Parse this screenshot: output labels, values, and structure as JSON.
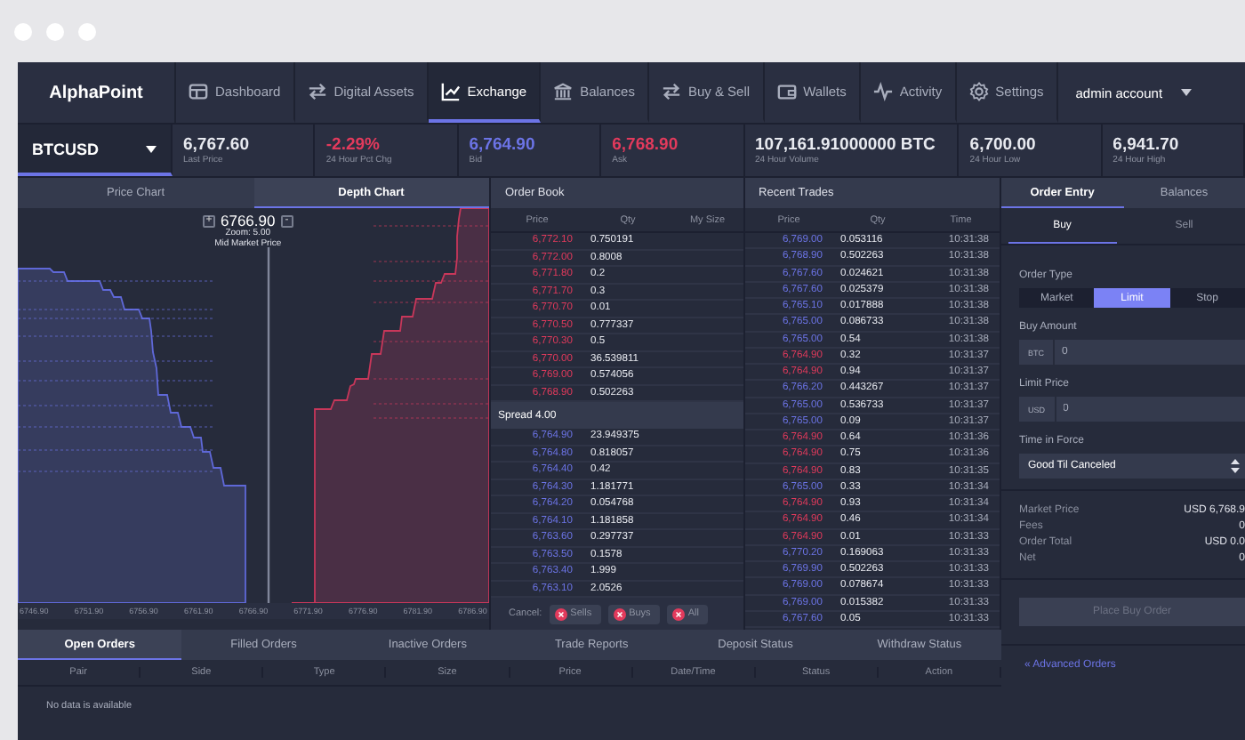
{
  "nav": {
    "logo": "AlphaPoint",
    "items": [
      {
        "label": "Dashboard",
        "selected": false
      },
      {
        "label": "Digital Assets",
        "selected": false
      },
      {
        "label": "Exchange",
        "selected": true
      },
      {
        "label": "Balances",
        "selected": false
      },
      {
        "label": "Buy & Sell",
        "selected": false
      },
      {
        "label": "Wallets",
        "selected": false
      },
      {
        "label": "Activity",
        "selected": false
      },
      {
        "label": "Settings",
        "selected": false
      }
    ],
    "account": "admin account"
  },
  "ticker": {
    "pair": "BTCUSD",
    "stats": [
      {
        "value": "6,767.60",
        "label": "Last Price",
        "kind": "plain"
      },
      {
        "value": "-2.29%",
        "label": "24 Hour Pct Chg",
        "kind": "sell"
      },
      {
        "value": "6,764.90",
        "label": "Bid",
        "kind": "buy"
      },
      {
        "value": "6,768.90",
        "label": "Ask",
        "kind": "sell"
      },
      {
        "value": "107,161.91000000 BTC",
        "label": "24 Hour Volume",
        "kind": "plain"
      },
      {
        "value": "6,700.00",
        "label": "24 Hour Low",
        "kind": "plain"
      },
      {
        "value": "6,941.70",
        "label": "24 Hour High",
        "kind": "plain"
      }
    ]
  },
  "chart_tabs": [
    {
      "label": "Price Chart",
      "selected": false
    },
    {
      "label": "Depth Chart",
      "selected": true
    }
  ],
  "depth_chart": {
    "mid_price": "6766.90",
    "zoom_in": "+",
    "zoom_out": "-",
    "zoom": "Zoom: 5.00",
    "mid_label": "Mid Market Price",
    "x_labels": [
      "6746.90",
      "6751.90",
      "6756.90",
      "6761.90",
      "6766.90",
      "6771.90",
      "6776.90",
      "6781.90",
      "6786.90"
    ]
  },
  "order_book": {
    "title": "Order Book",
    "columns": [
      "Price",
      "Qty",
      "My Size"
    ],
    "asks": [
      {
        "price": "6,772.10",
        "qty": "0.750191"
      },
      {
        "price": "6,772.00",
        "qty": "0.8008"
      },
      {
        "price": "6,771.80",
        "qty": "0.2"
      },
      {
        "price": "6,771.70",
        "qty": "0.3"
      },
      {
        "price": "6,770.70",
        "qty": "0.01"
      },
      {
        "price": "6,770.50",
        "qty": "0.777337"
      },
      {
        "price": "6,770.30",
        "qty": "0.5"
      },
      {
        "price": "6,770.00",
        "qty": "36.539811"
      },
      {
        "price": "6,769.00",
        "qty": "0.574056"
      },
      {
        "price": "6,768.90",
        "qty": "0.502263"
      }
    ],
    "spread": "Spread 4.00",
    "bids": [
      {
        "price": "6,764.90",
        "qty": "23.949375"
      },
      {
        "price": "6,764.80",
        "qty": "0.818057"
      },
      {
        "price": "6,764.40",
        "qty": "0.42"
      },
      {
        "price": "6,764.30",
        "qty": "1.181771"
      },
      {
        "price": "6,764.20",
        "qty": "0.054768"
      },
      {
        "price": "6,764.10",
        "qty": "1.181858"
      },
      {
        "price": "6,763.60",
        "qty": "0.297737"
      },
      {
        "price": "6,763.50",
        "qty": "0.1578"
      },
      {
        "price": "6,763.40",
        "qty": "1.999"
      },
      {
        "price": "6,763.10",
        "qty": "2.0526"
      }
    ],
    "cancel_label": "Cancel:",
    "cancel_buttons": [
      "Sells",
      "Buys",
      "All"
    ]
  },
  "recent_trades": {
    "title": "Recent Trades",
    "columns": [
      "Price",
      "Qty",
      "Time"
    ],
    "rows": [
      {
        "price": "6,769.00",
        "qty": "0.053116",
        "time": "10:31:38",
        "kind": "buy"
      },
      {
        "price": "6,768.90",
        "qty": "0.502263",
        "time": "10:31:38",
        "kind": "buy"
      },
      {
        "price": "6,767.60",
        "qty": "0.024621",
        "time": "10:31:38",
        "kind": "buy"
      },
      {
        "price": "6,767.60",
        "qty": "0.025379",
        "time": "10:31:38",
        "kind": "buy"
      },
      {
        "price": "6,765.10",
        "qty": "0.017888",
        "time": "10:31:38",
        "kind": "buy"
      },
      {
        "price": "6,765.00",
        "qty": "0.086733",
        "time": "10:31:38",
        "kind": "buy"
      },
      {
        "price": "6,765.00",
        "qty": "0.54",
        "time": "10:31:38",
        "kind": "buy"
      },
      {
        "price": "6,764.90",
        "qty": "0.32",
        "time": "10:31:37",
        "kind": "sell"
      },
      {
        "price": "6,764.90",
        "qty": "0.94",
        "time": "10:31:37",
        "kind": "sell"
      },
      {
        "price": "6,766.20",
        "qty": "0.443267",
        "time": "10:31:37",
        "kind": "buy"
      },
      {
        "price": "6,765.00",
        "qty": "0.536733",
        "time": "10:31:37",
        "kind": "buy"
      },
      {
        "price": "6,765.00",
        "qty": "0.09",
        "time": "10:31:37",
        "kind": "buy"
      },
      {
        "price": "6,764.90",
        "qty": "0.64",
        "time": "10:31:36",
        "kind": "sell"
      },
      {
        "price": "6,764.90",
        "qty": "0.75",
        "time": "10:31:36",
        "kind": "sell"
      },
      {
        "price": "6,764.90",
        "qty": "0.83",
        "time": "10:31:35",
        "kind": "sell"
      },
      {
        "price": "6,765.00",
        "qty": "0.33",
        "time": "10:31:34",
        "kind": "buy"
      },
      {
        "price": "6,764.90",
        "qty": "0.93",
        "time": "10:31:34",
        "kind": "sell"
      },
      {
        "price": "6,764.90",
        "qty": "0.46",
        "time": "10:31:34",
        "kind": "sell"
      },
      {
        "price": "6,764.90",
        "qty": "0.01",
        "time": "10:31:33",
        "kind": "sell"
      },
      {
        "price": "6,770.20",
        "qty": "0.169063",
        "time": "10:31:33",
        "kind": "buy"
      },
      {
        "price": "6,769.90",
        "qty": "0.502263",
        "time": "10:31:33",
        "kind": "buy"
      },
      {
        "price": "6,769.00",
        "qty": "0.078674",
        "time": "10:31:33",
        "kind": "buy"
      },
      {
        "price": "6,769.00",
        "qty": "0.015382",
        "time": "10:31:33",
        "kind": "buy"
      },
      {
        "price": "6,767.60",
        "qty": "0.05",
        "time": "10:31:33",
        "kind": "buy"
      }
    ]
  },
  "order_entry": {
    "tabs": [
      {
        "label": "Order Entry",
        "selected": true
      },
      {
        "label": "Balances",
        "selected": false
      }
    ],
    "sides": [
      {
        "label": "Buy",
        "selected": true
      },
      {
        "label": "Sell",
        "selected": false
      }
    ],
    "order_type_label": "Order Type",
    "order_types": [
      {
        "label": "Market",
        "selected": false
      },
      {
        "label": "Limit",
        "selected": true
      },
      {
        "label": "Stop",
        "selected": false
      }
    ],
    "amount": {
      "label": "Buy Amount",
      "unit": "BTC",
      "value": "0"
    },
    "limit_price": {
      "label": "Limit Price",
      "unit": "USD",
      "value": "0"
    },
    "time_in_force": {
      "label": "Time in Force",
      "value": "Good Til Canceled"
    },
    "summary": [
      {
        "label": "Market Price",
        "value": "USD 6,768.9"
      },
      {
        "label": "Fees",
        "value": "0"
      },
      {
        "label": "Order Total",
        "value": "USD 0.0"
      },
      {
        "label": "Net",
        "value": "0"
      }
    ],
    "submit": {
      "label": "Place Buy Order",
      "disabled": true
    },
    "advanced": "« Advanced Orders"
  },
  "orders": {
    "tabs": [
      {
        "label": "Open Orders",
        "selected": true
      },
      {
        "label": "Filled Orders",
        "selected": false
      },
      {
        "label": "Inactive Orders",
        "selected": false
      },
      {
        "label": "Trade Reports",
        "selected": false
      },
      {
        "label": "Deposit Status",
        "selected": false
      },
      {
        "label": "Withdraw Status",
        "selected": false
      }
    ],
    "columns": [
      "Pair",
      "Side",
      "Type",
      "Size",
      "Price",
      "Date/Time",
      "Status",
      "Action"
    ],
    "empty": "No data is available"
  }
}
